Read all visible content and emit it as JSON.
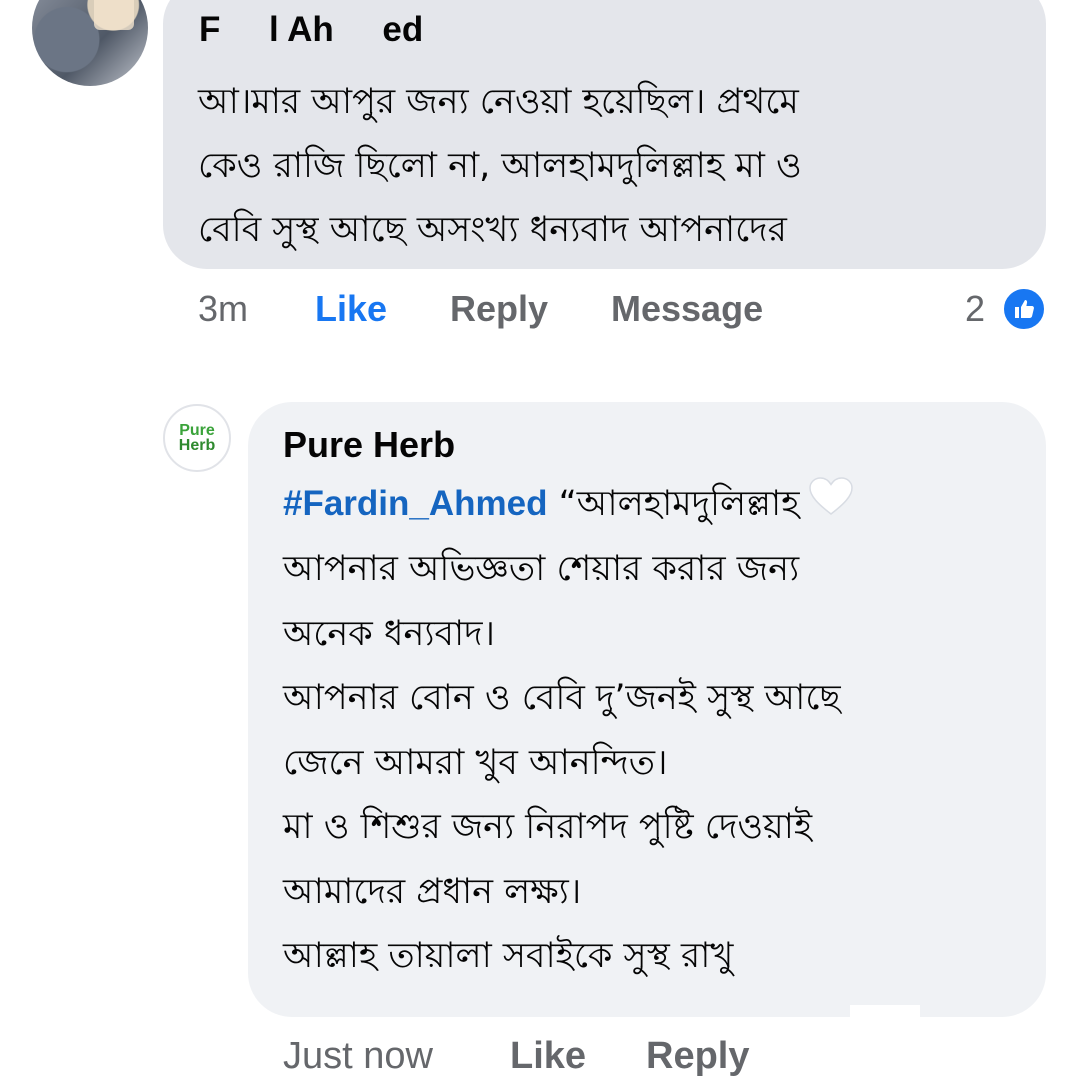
{
  "comment1": {
    "author": "F     l Ah     ed",
    "text_lines": [
      "আ।মার আপুর জন্য নেওয়া হয়েছিল। প্রথমে",
      "কেও রাজি ছিলো না, আলহামদুলিল্লাহ মা ও",
      "বেবি সুস্থ আছে অসংখ্য ধন্যবাদ আপনাদের"
    ],
    "time": "3m",
    "like_label": "Like",
    "reply_label": "Reply",
    "message_label": "Message",
    "reaction_count": "2",
    "reaction_icon": "like-icon"
  },
  "comment2": {
    "author": "Pure Herb",
    "avatar_text": [
      "Pure",
      "Herb"
    ],
    "mention": "#Fardin_Ahmed",
    "first_line_rest": "“আলহামদুলিল্লাহ",
    "heart_icon": "white-heart-icon",
    "text_lines": [
      "আপনার অভিজ্ঞতা শেয়ার করার জন্য",
      "অনেক ধন্যবাদ।",
      "আপনার বোন ও বেবি দু’জনই সুস্থ আছে",
      "জেনে আমরা খুব আনন্দিত।",
      "মা ও শিশুর জন্য নিরাপদ পুষ্টি দেওয়াই",
      "আমাদের প্রধান লক্ষ্য।",
      "আল্লাহ তায়ালা সবাইকে সুস্থ রাখু"
    ],
    "time": "Just now",
    "like_label": "Like",
    "reply_label": "Reply"
  },
  "colors": {
    "link_blue": "#1877f2",
    "meta_gray": "#65676b",
    "bubble_gray": "#e4e6eb",
    "bubble_light": "#f0f2f5",
    "brand_green": "#3aa33a"
  }
}
